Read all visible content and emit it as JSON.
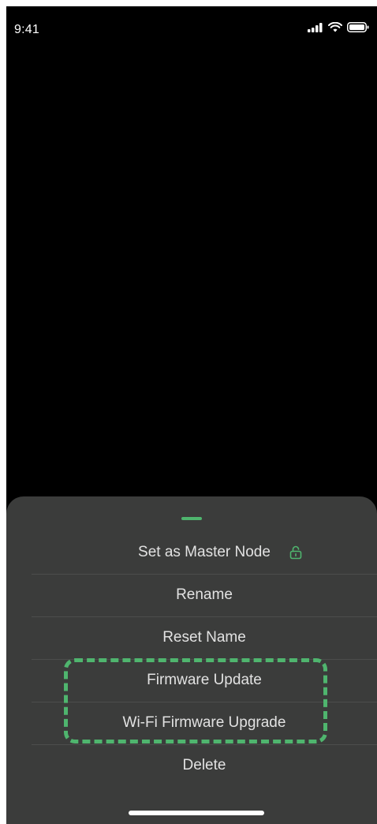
{
  "status_bar": {
    "time": "9:41",
    "signal_icon": "signal-bars-icon",
    "wifi_icon": "wifi-icon",
    "battery_icon": "battery-icon"
  },
  "sheet": {
    "grabber_color": "#4fb56e",
    "items": [
      {
        "label": "Set as Master Node",
        "icon": "lock-open-icon",
        "icon_color": "#4fb56e"
      },
      {
        "label": "Rename"
      },
      {
        "label": "Reset Name"
      },
      {
        "label": "Firmware Update"
      },
      {
        "label": "Wi-Fi Firmware Upgrade"
      },
      {
        "label": "Delete"
      }
    ],
    "highlight_color": "#4fb56e"
  },
  "colors": {
    "background": "#000000",
    "sheet_background": "#3b3c3b",
    "text": "#e2e2e2",
    "accent": "#4fb56e"
  }
}
